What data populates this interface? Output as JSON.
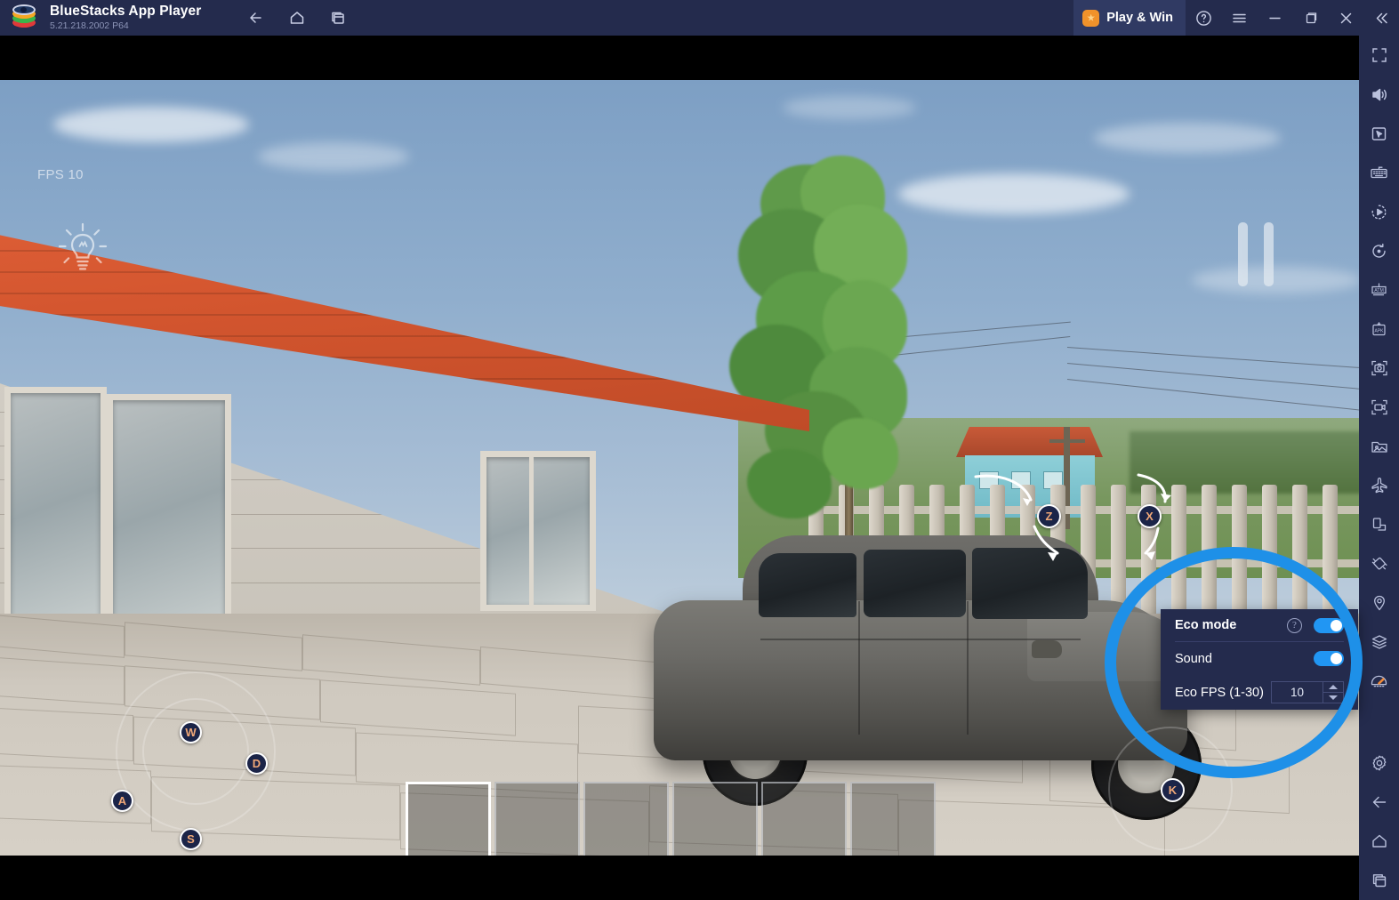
{
  "window": {
    "title": "BlueStacks App Player",
    "version": "5.21.218.2002  P64",
    "logo_name": "bluestacks-logo"
  },
  "titlebar": {
    "nav": [
      {
        "name": "back-icon",
        "label": "Back"
      },
      {
        "name": "home-icon",
        "label": "Home"
      },
      {
        "name": "multi-instance-icon",
        "label": "Multi-instance"
      }
    ],
    "play_and_win": "Play & Win",
    "controls": [
      {
        "name": "help-icon",
        "label": "Help"
      },
      {
        "name": "menu-icon",
        "label": "Menu"
      },
      {
        "name": "minimize-icon",
        "label": "Minimize"
      },
      {
        "name": "maximize-icon",
        "label": "Restore"
      },
      {
        "name": "close-icon",
        "label": "Close"
      },
      {
        "name": "collapse-sidebar-icon",
        "label": "Collapse"
      }
    ]
  },
  "sidebar": {
    "items": [
      {
        "name": "fullscreen-icon",
        "label": "Full screen"
      },
      {
        "name": "volume-icon",
        "label": "Volume"
      },
      {
        "name": "cursor-pointer-icon",
        "label": "Game controls"
      },
      {
        "name": "keyboard-icon",
        "label": "Keymapping"
      },
      {
        "name": "macro-record-icon",
        "label": "Macro recorder"
      },
      {
        "name": "rotate-icon",
        "label": "Rotate"
      },
      {
        "name": "atm-icon",
        "label": "ATM / Auto tap"
      },
      {
        "name": "apk-install-icon",
        "label": "Install APK"
      },
      {
        "name": "screenshot-icon",
        "label": "Screenshot"
      },
      {
        "name": "record-screen-icon",
        "label": "Record screen"
      },
      {
        "name": "media-manager-icon",
        "label": "Media manager"
      },
      {
        "name": "airplane-icon",
        "label": "Airplane mode"
      },
      {
        "name": "orientation-icon",
        "label": "Orientation"
      },
      {
        "name": "shake-icon",
        "label": "Shake"
      },
      {
        "name": "location-icon",
        "label": "Location"
      },
      {
        "name": "layers-icon",
        "label": "Layers"
      },
      {
        "name": "eco-mode-icon",
        "label": "Eco mode"
      },
      {
        "name": "settings-gear-icon",
        "label": "Settings"
      },
      {
        "name": "nav-back-icon",
        "label": "Back"
      },
      {
        "name": "nav-home-icon",
        "label": "Home"
      },
      {
        "name": "nav-recents-icon",
        "label": "Recent apps"
      }
    ]
  },
  "game": {
    "fps_overlay": "FPS 10",
    "bulb_icon": "lightbulb-icon",
    "pause_icon": "pause-icon",
    "keys": [
      {
        "name": "key-w",
        "label": "W"
      },
      {
        "name": "key-a",
        "label": "A"
      },
      {
        "name": "key-s",
        "label": "S"
      },
      {
        "name": "key-d",
        "label": "D"
      },
      {
        "name": "key-z",
        "label": "Z"
      },
      {
        "name": "key-x",
        "label": "X"
      },
      {
        "name": "key-k",
        "label": "K"
      }
    ],
    "hotbar_slots": 6,
    "hotbar_selected_index": 0
  },
  "eco_panel": {
    "title": "Eco mode",
    "help": "?",
    "eco_toggle_on": true,
    "sound_label": "Sound",
    "sound_toggle_on": true,
    "fps_label": "Eco FPS (1-30)",
    "fps_value": "10",
    "accent_color": "#2196f3",
    "panel_color": "#242b4d"
  },
  "annotation": {
    "name": "highlight-circle",
    "color": "#1e90e8"
  }
}
